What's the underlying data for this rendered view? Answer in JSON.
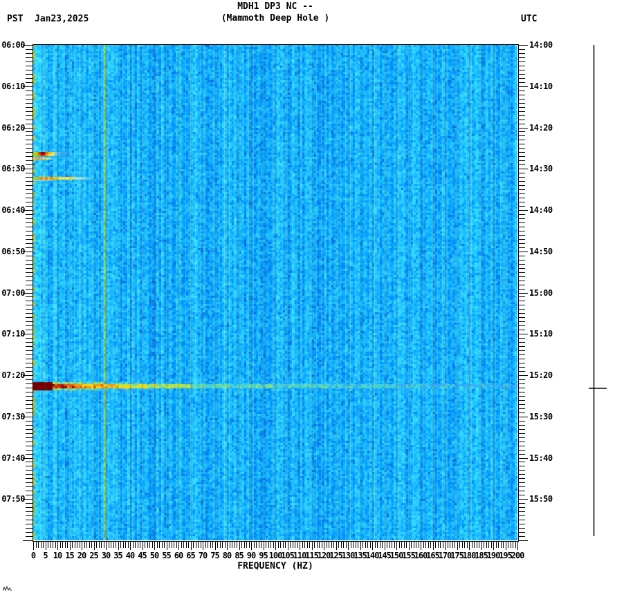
{
  "header": {
    "timezone_left": "PST",
    "date": "Jan23,2025",
    "title_line1": "MDH1 DP3 NC --",
    "title_line2": "(Mammoth Deep Hole )",
    "timezone_right": "UTC"
  },
  "y_axis_left": {
    "timezone": "PST",
    "labels": [
      "06:00",
      "06:10",
      "06:20",
      "06:30",
      "06:40",
      "06:50",
      "07:00",
      "07:10",
      "07:20",
      "07:30",
      "07:40",
      "07:50"
    ]
  },
  "y_axis_right": {
    "timezone": "UTC",
    "labels": [
      "14:00",
      "14:10",
      "14:20",
      "14:30",
      "14:40",
      "14:50",
      "15:00",
      "15:10",
      "15:20",
      "15:30",
      "15:40",
      "15:50"
    ]
  },
  "x_axis": {
    "label": "FREQUENCY (HZ)",
    "tick_labels": [
      "0",
      "5",
      "10",
      "15",
      "20",
      "25",
      "30",
      "35",
      "40",
      "45",
      "50",
      "55",
      "60",
      "65",
      "70",
      "75",
      "80",
      "85",
      "90",
      "95",
      "100",
      "105",
      "110",
      "115",
      "120",
      "125",
      "130",
      "135",
      "140",
      "145",
      "150",
      "155",
      "160",
      "165",
      "170",
      "175",
      "180",
      "185",
      "190",
      "195",
      "200"
    ]
  },
  "chart_data": {
    "type": "heatmap",
    "subtype": "seismic-spectrogram",
    "station": "MDH1 DP3 NC --",
    "station_name": "Mammoth Deep Hole",
    "date": "Jan23,2025",
    "xlabel": "FREQUENCY (HZ)",
    "x_range_hz": [
      0,
      200
    ],
    "x_major_tick_step_hz": 5,
    "x_minor_tick_step_hz": 1,
    "y_left_timezone": "PST",
    "y_right_timezone": "UTC",
    "y_range_pst": [
      "06:00",
      "08:00"
    ],
    "y_range_utc": [
      "14:00",
      "16:00"
    ],
    "y_major_tick_step_min": 10,
    "grid": "vertical gray-olive gridline every 5 Hz",
    "colormap": "jet-like: blue = low power, cyan/green/yellow/orange/red = increasing power",
    "background": "broadband blue noise, slightly brighter (cyan) below ~12 Hz",
    "persistent_features": [
      {
        "freq_hz": 0.5,
        "color": "#a8cc00",
        "desc": "intermittent yellow-green band at left edge (microseism)"
      },
      {
        "freq_hz": 29.5,
        "color": "#b8d820",
        "desc": "continuous yellow-green tonal line full height"
      },
      {
        "freq_hz": 60,
        "color": "#33bb99",
        "desc": "faint green 60 Hz mains-hum line full height"
      }
    ],
    "events": [
      {
        "id": "e1",
        "time_pst": "06:26",
        "time_utc": "14:26",
        "freq_span_hz": [
          0,
          14
        ],
        "intensity": "strong",
        "peak_colors": [
          "#8c0000",
          "#d42000",
          "#ffb400"
        ],
        "desc": "compact red/orange blob at low frequency"
      },
      {
        "id": "e1b",
        "time_pst": "06:27",
        "time_utc": "14:27",
        "freq_span_hz": [
          0,
          9
        ],
        "intensity": "moderate",
        "peak_colors": [
          "#ffa020"
        ],
        "desc": "short orange streak"
      },
      {
        "id": "e2",
        "time_pst": "06:32",
        "time_utc": "14:32",
        "freq_span_hz": [
          0,
          28
        ],
        "intensity": "moderate",
        "peak_colors": [
          "#ff9800",
          "#ffe030"
        ],
        "desc": "yellow-orange streak fading to cyan"
      },
      {
        "id": "main",
        "time_pst": "07:22",
        "time_utc": "15:22",
        "freq_span_hz": [
          0,
          200
        ],
        "intensity": "very strong",
        "peak_colors": [
          "#7a0000",
          "#c41000",
          "#ff9600",
          "#ffd900",
          "#cfe42e",
          "#48d4d0"
        ],
        "desc": "broadband earthquake: maroon 0-8 Hz grading through red/orange/yellow/green to light blue at 200 Hz"
      }
    ]
  },
  "amplitude_trace": {
    "desc": "flat vertical amplitude trace at far right",
    "spike_time_pst": "07:22",
    "spike_time_utc": "15:22"
  },
  "watermark": {
    "glyph": "tiny-zigzag-mark"
  },
  "palette": {
    "noise_base": "#0080ff",
    "noise_cyan": "#00bfff",
    "noise_dark": "#0055dd",
    "gridline": "rgba(100,100,70,0.45)",
    "axis": "#000000"
  }
}
